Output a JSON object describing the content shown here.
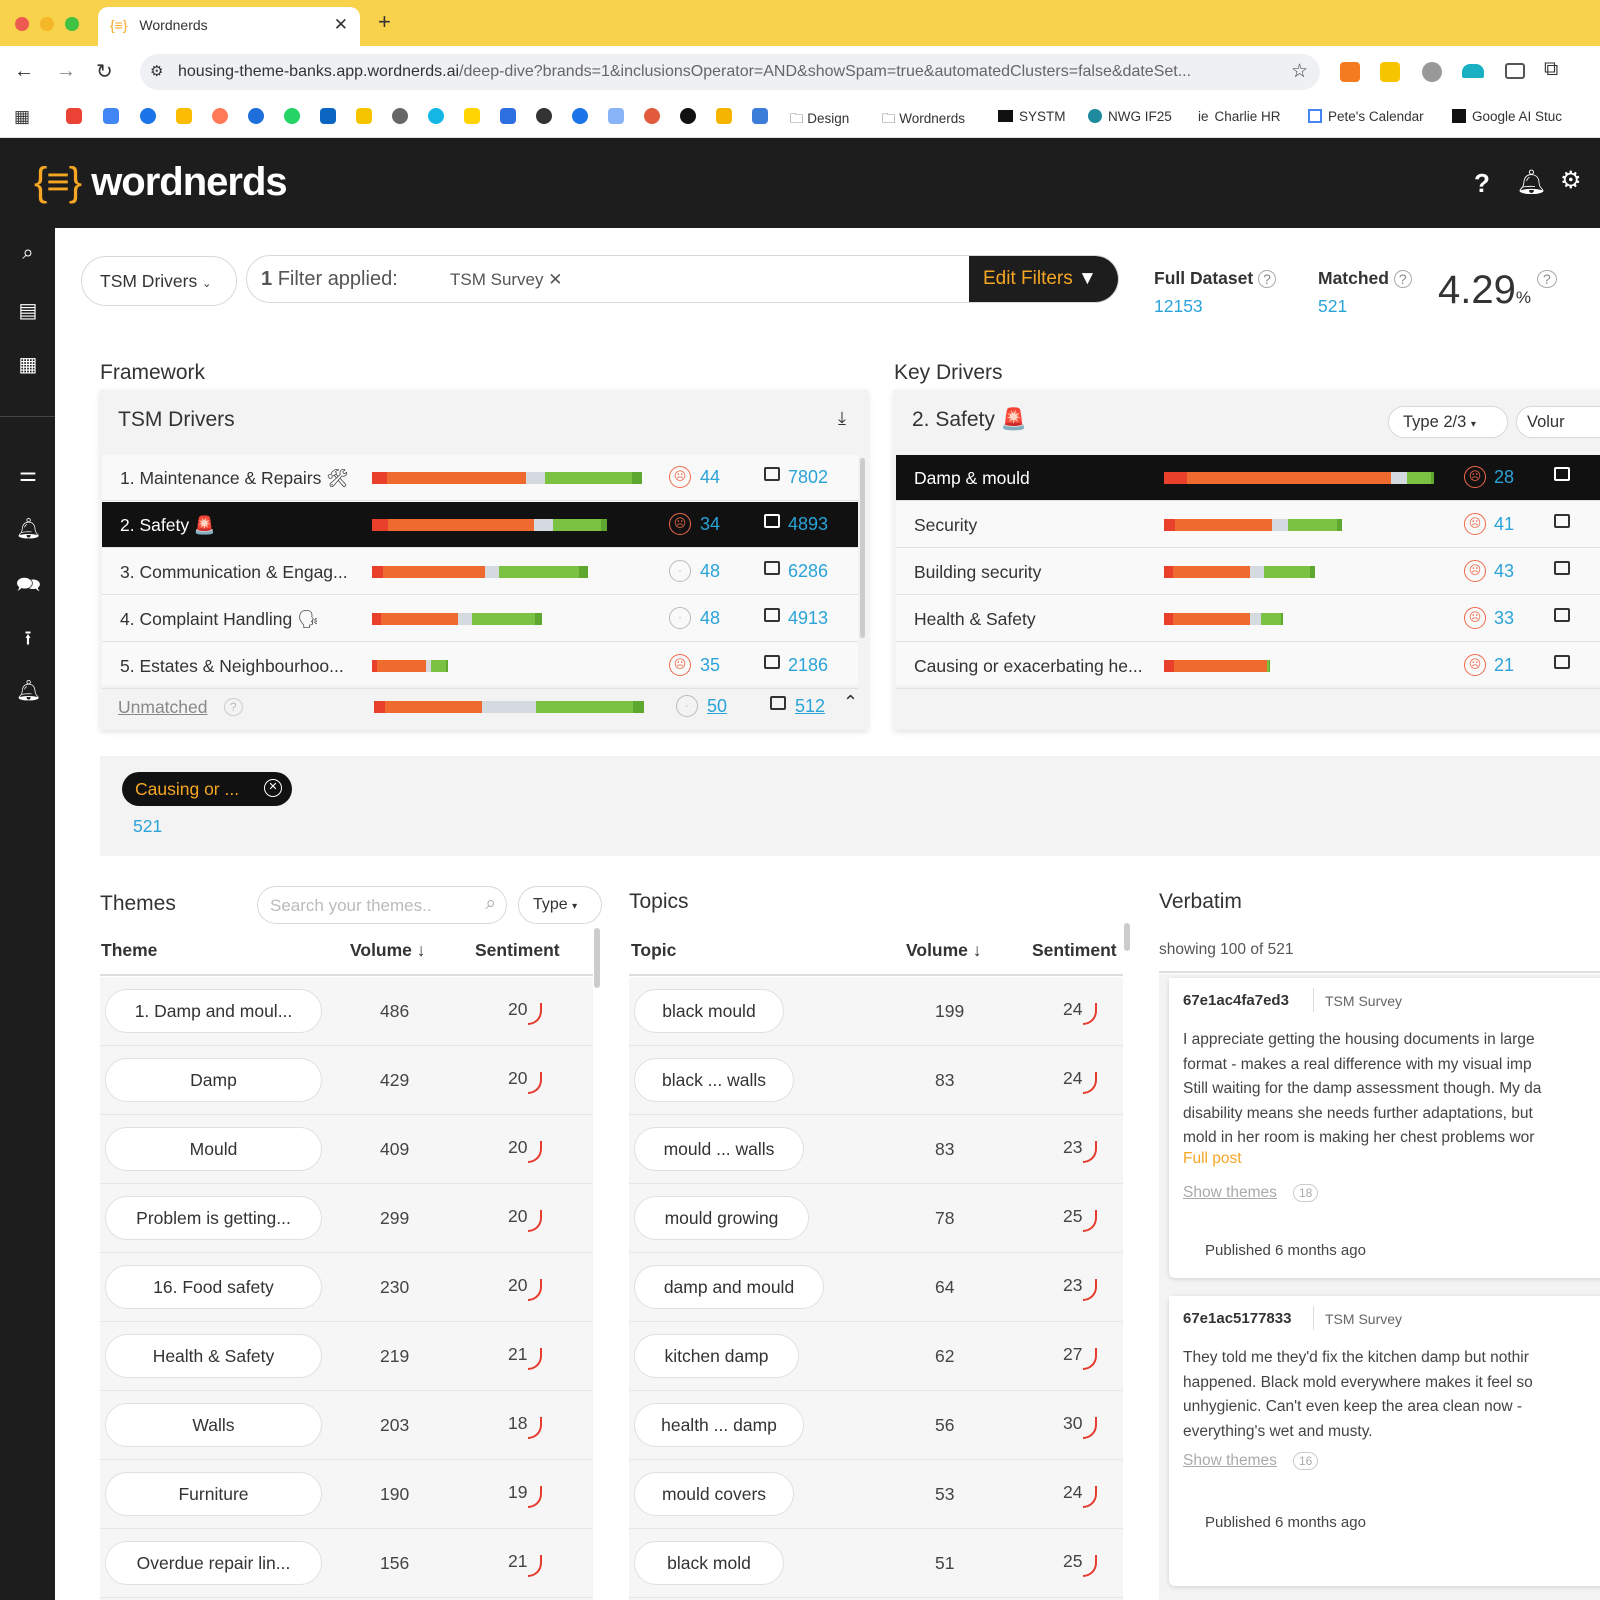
{
  "browser": {
    "tab_title": "Wordnerds",
    "url_host": "housing-theme-banks.app.wordnerds.ai",
    "url_path": "/deep-dive?brands=1&inclusionsOperator=AND&showSpam=true&automatedClusters=false&dateSet...",
    "bookmarks": [
      "Design",
      "Wordnerds",
      "SYSTM",
      "NWG IF25",
      "Charlie HR",
      "Pete's Calendar",
      "Google AI Stuc"
    ]
  },
  "app": {
    "logo": "wordnerds",
    "logo_brackets": "{≡}",
    "help": "?"
  },
  "filterbar": {
    "framework_select": "TSM Drivers",
    "filter_count": "1",
    "filter_text": "Filter applied:",
    "filter_chip": "TSM Survey",
    "edit_filters": "Edit Filters",
    "full_dataset_label": "Full Dataset",
    "full_dataset_value": "12153",
    "matched_label": "Matched",
    "matched_value": "521",
    "percent": "4.29",
    "percent_sign": "%"
  },
  "framework": {
    "section_title": "Framework",
    "card_title": "TSM Drivers",
    "rows": [
      {
        "label": "1. Maintenance & Repairs 🛠",
        "neg": 57,
        "neu": 7,
        "pos": 36,
        "sentiment": "44",
        "comments": "7802",
        "face": "neg"
      },
      {
        "label": "2. Safety 🚨",
        "neg": 60,
        "neu": 7,
        "pos": 20,
        "sentiment": "34",
        "comments": "4893",
        "face": "neg"
      },
      {
        "label": "3. Communication & Engag...",
        "neg": 42,
        "neu": 5,
        "pos": 33,
        "sentiment": "48",
        "comments": "6286",
        "face": "neu"
      },
      {
        "label": "4. Complaint Handling 🗣",
        "neg": 32,
        "neu": 5,
        "pos": 26,
        "sentiment": "48",
        "comments": "4913",
        "face": "neu"
      },
      {
        "label": "5. Estates & Neighbourhoo...",
        "neg": 20,
        "neu": 2,
        "pos": 6,
        "sentiment": "35",
        "comments": "2186",
        "face": "neg"
      }
    ],
    "unmatched": {
      "label": "Unmatched",
      "sentiment": "50",
      "comments": "512",
      "neg": 40,
      "neu": 20,
      "pos": 40
    }
  },
  "key_drivers": {
    "section_title": "Key Drivers",
    "card_title": "2. Safety 🚨",
    "type_select": "Type 2/3",
    "volume_select": "Volur",
    "rows": [
      {
        "label": "Damp & mould",
        "neg": 84,
        "neu": 6,
        "pos": 10,
        "sentiment": "28",
        "selected": true
      },
      {
        "label": "Security",
        "neg": 40,
        "neu": 6,
        "pos": 20,
        "sentiment": "41"
      },
      {
        "label": "Building security",
        "neg": 32,
        "neu": 5,
        "pos": 19,
        "sentiment": "43"
      },
      {
        "label": "Health & Safety",
        "neg": 32,
        "neu": 4,
        "pos": 8,
        "sentiment": "33"
      },
      {
        "label": "Causing or exacerbating he...",
        "neg": 38,
        "neu": 0,
        "pos": 1,
        "sentiment": "21"
      }
    ]
  },
  "selection": {
    "chip": "Causing or ...",
    "count": "521"
  },
  "themes": {
    "title": "Themes",
    "search_placeholder": "Search your themes..",
    "type_select": "Type",
    "headers": {
      "theme": "Theme",
      "volume": "Volume",
      "sentiment": "Sentiment"
    },
    "rows": [
      {
        "name": "1. Damp and moul...",
        "volume": "486",
        "sentiment": "20"
      },
      {
        "name": "Damp",
        "volume": "429",
        "sentiment": "20"
      },
      {
        "name": "Mould",
        "volume": "409",
        "sentiment": "20"
      },
      {
        "name": "Problem is getting...",
        "volume": "299",
        "sentiment": "20"
      },
      {
        "name": "16. Food safety",
        "volume": "230",
        "sentiment": "20"
      },
      {
        "name": "Health & Safety",
        "volume": "219",
        "sentiment": "21"
      },
      {
        "name": "Walls",
        "volume": "203",
        "sentiment": "18"
      },
      {
        "name": "Furniture",
        "volume": "190",
        "sentiment": "19"
      },
      {
        "name": "Overdue repair lin...",
        "volume": "156",
        "sentiment": "21"
      }
    ]
  },
  "topics": {
    "title": "Topics",
    "headers": {
      "topic": "Topic",
      "volume": "Volume",
      "sentiment": "Sentiment"
    },
    "rows": [
      {
        "name": "black mould",
        "volume": "199",
        "sentiment": "24"
      },
      {
        "name": "black ... walls",
        "volume": "83",
        "sentiment": "24"
      },
      {
        "name": "mould ... walls",
        "volume": "83",
        "sentiment": "23"
      },
      {
        "name": "mould growing",
        "volume": "78",
        "sentiment": "25"
      },
      {
        "name": "damp and mould",
        "volume": "64",
        "sentiment": "23"
      },
      {
        "name": "kitchen damp",
        "volume": "62",
        "sentiment": "27"
      },
      {
        "name": "health ... damp",
        "volume": "56",
        "sentiment": "30"
      },
      {
        "name": "mould covers",
        "volume": "53",
        "sentiment": "24"
      },
      {
        "name": "black mold",
        "volume": "51",
        "sentiment": "25"
      }
    ]
  },
  "verbatim": {
    "title": "Verbatim",
    "showing": "showing 100 of 521",
    "posts": [
      {
        "id": "67e1ac4fa7ed3",
        "source": "TSM Survey",
        "lines": [
          "I appreciate getting the housing documents in large",
          "format - makes a real difference with my visual imp",
          "Still waiting for the damp assessment though. My da",
          "disability means she needs further adaptations, but",
          "mold in her room is making her chest problems wor"
        ],
        "full_post": "Full post",
        "show_themes": "Show themes",
        "theme_count": "18",
        "published": "Published 6 months ago"
      },
      {
        "id": "67e1ac5177833",
        "source": "TSM Survey",
        "lines": [
          "They told me they'd fix the kitchen damp but nothir",
          "happened. Black mold everywhere makes it feel so",
          "unhygienic. Can't even keep the area clean now -",
          "everything's wet and musty."
        ],
        "show_themes": "Show themes",
        "theme_count": "16",
        "published": "Published 6 months ago"
      }
    ]
  },
  "colors": {
    "negative": "#ee6a2f",
    "negative_dark": "#e8402b",
    "neutral": "#d4dadf",
    "positive": "#7cc242",
    "positive_dark": "#5fa830",
    "link": "#2aa3d8",
    "accent": "#f5a623"
  }
}
